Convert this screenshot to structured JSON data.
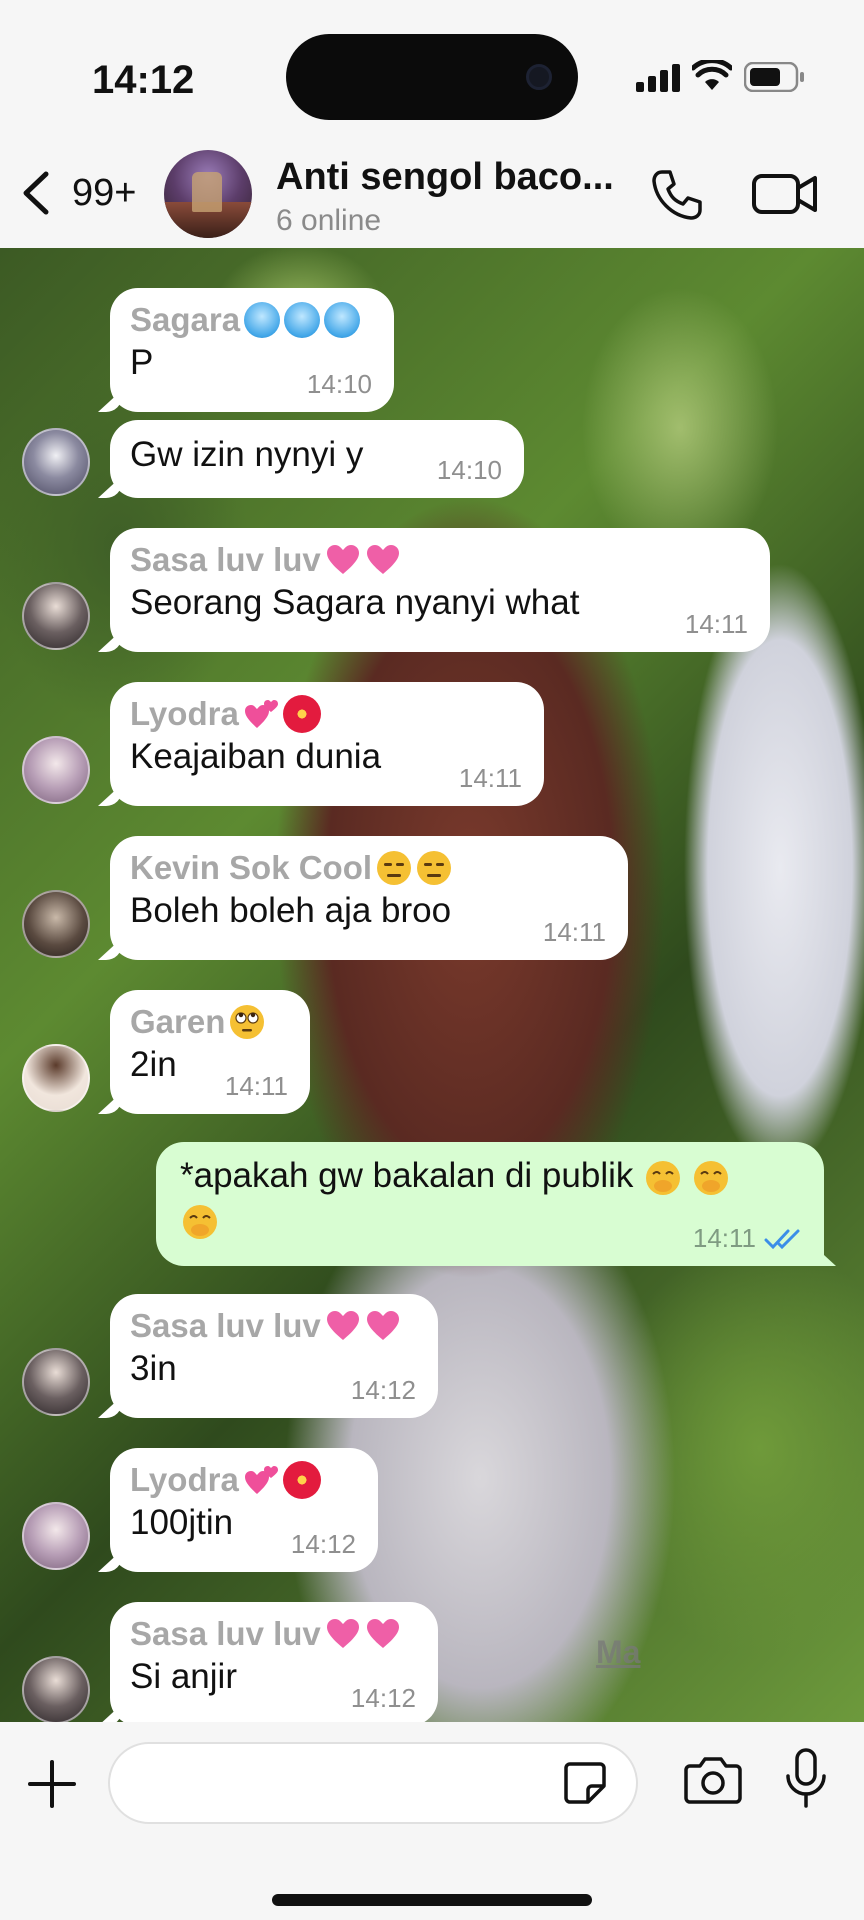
{
  "status_bar": {
    "time": "14:12"
  },
  "header": {
    "unread_count": "99+",
    "group_name": "Anti sengol baco...",
    "subtitle": "6 online"
  },
  "messages": [
    {
      "sender": "Sagara",
      "sender_emoji": [
        "cold-face",
        "cold-face",
        "cold-face"
      ],
      "text": "P",
      "time": "14:10"
    },
    {
      "sender": "",
      "text": "Gw izin nynyi y",
      "time": "14:10"
    },
    {
      "sender": "Sasa luv luv",
      "sender_emoji": [
        "heart",
        "heart"
      ],
      "text": "Seorang Sagara nyanyi what",
      "time": "14:11"
    },
    {
      "sender": "Lyodra",
      "sender_emoji": [
        "two-hearts",
        "hibiscus"
      ],
      "text": "Keajaiban dunia",
      "time": "14:11"
    },
    {
      "sender": "Kevin Sok Cool",
      "sender_emoji": [
        "expressionless",
        "expressionless"
      ],
      "text": "Boleh boleh aja broo",
      "time": "14:11"
    },
    {
      "sender": "Garen",
      "sender_emoji": [
        "eye-roll"
      ],
      "text": "2in",
      "time": "14:11"
    },
    {
      "sender": "",
      "outgoing": true,
      "text": "*apakah gw bakalan di publik",
      "time": "14:11",
      "status": "read"
    },
    {
      "sender": "Sasa luv luv",
      "sender_emoji": [
        "heart",
        "heart"
      ],
      "text": "3in",
      "time": "14:12"
    },
    {
      "sender": "Lyodra",
      "sender_emoji": [
        "two-hearts",
        "hibiscus"
      ],
      "text": "100jtin",
      "time": "14:12"
    },
    {
      "sender": "Sasa luv luv",
      "sender_emoji": [
        "heart",
        "heart"
      ],
      "text": "Si anjir",
      "time": "14:12"
    }
  ],
  "watermark": "Ma",
  "colors": {
    "outgoing_bubble": "#d8fdd2",
    "read_ticks": "#3b8ee8",
    "incoming_bubble": "#ffffff"
  },
  "icons": [
    "back-chevron-icon",
    "phone-icon",
    "video-camera-icon",
    "plus-icon",
    "sticker-icon",
    "camera-icon",
    "microphone-icon"
  ]
}
